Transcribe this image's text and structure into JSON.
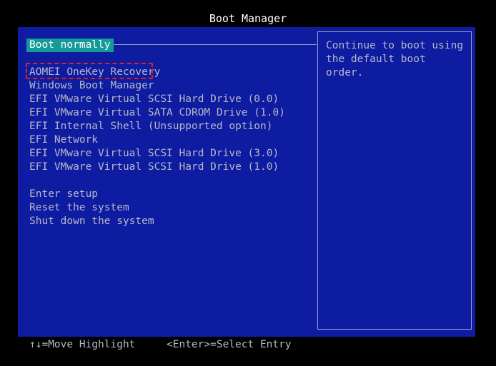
{
  "window": {
    "title": "Boot Manager"
  },
  "boot_menu": {
    "selected": "Boot normally",
    "entries": [
      "AOMEI OneKey Recovery",
      "Windows Boot Manager",
      "EFI VMware Virtual SCSI Hard Drive (0.0)",
      "EFI VMware Virtual SATA CDROM Drive (1.0)",
      "EFI Internal Shell (Unsupported option)",
      "EFI Network",
      "EFI VMware Virtual SCSI Hard Drive (3.0)",
      "EFI VMware Virtual SCSI Hard Drive (1.0)"
    ],
    "actions": [
      "Enter setup",
      "Reset the system",
      "Shut down the system"
    ]
  },
  "help": {
    "text": "Continue to boot using\nthe default boot order."
  },
  "footer": {
    "move_hint": "↑↓=Move Highlight",
    "select_hint": "<Enter>=Select Entry"
  },
  "colors": {
    "background": "#000000",
    "panel": "#0d1ca0",
    "selection": "#159a9a",
    "annotation": "#e02020",
    "text": "#b8b8c8"
  }
}
